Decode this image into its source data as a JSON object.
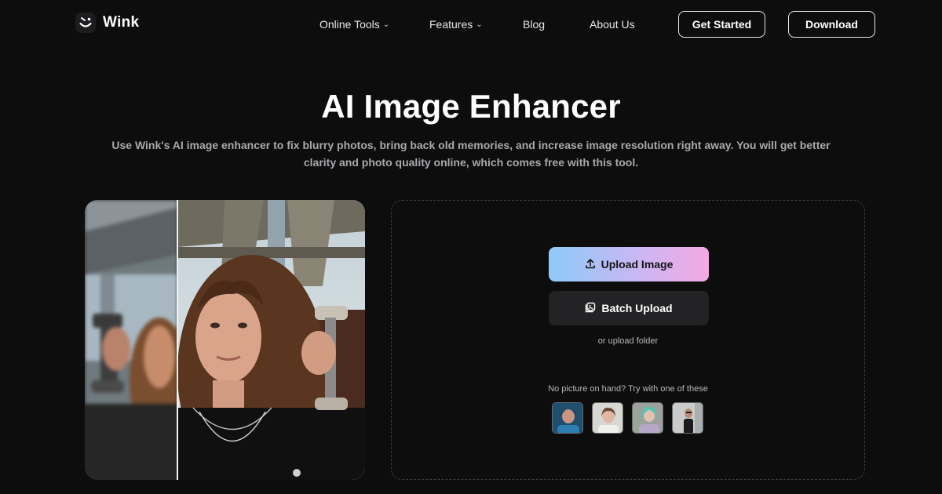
{
  "brand": {
    "name": "Wink"
  },
  "nav": {
    "online_tools": "Online Tools",
    "features": "Features",
    "blog": "Blog",
    "about": "About Us"
  },
  "header_actions": {
    "get_started": "Get Started",
    "download": "Download"
  },
  "hero": {
    "title": "AI Image Enhancer",
    "subtitle": "Use Wink's AI image enhancer to fix blurry photos, bring back old memories, and increase image resolution right away. You will get better clarity and photo quality online, which comes free with this tool."
  },
  "upload": {
    "upload_image": "Upload Image",
    "batch_upload": "Batch Upload",
    "upload_folder": "or upload folder",
    "sample_label": "No picture on hand? Try with one of these"
  },
  "colors": {
    "background": "#0d0d0e",
    "upload_gradient": [
      "#8ecaf8",
      "#c9b7f4",
      "#f4a9e3"
    ],
    "batch_button": "#232325"
  },
  "icons": {
    "logo": "wink-logo-icon",
    "chevron": "chevron-down-icon",
    "upload": "upload-icon",
    "batch": "batch-images-icon"
  }
}
